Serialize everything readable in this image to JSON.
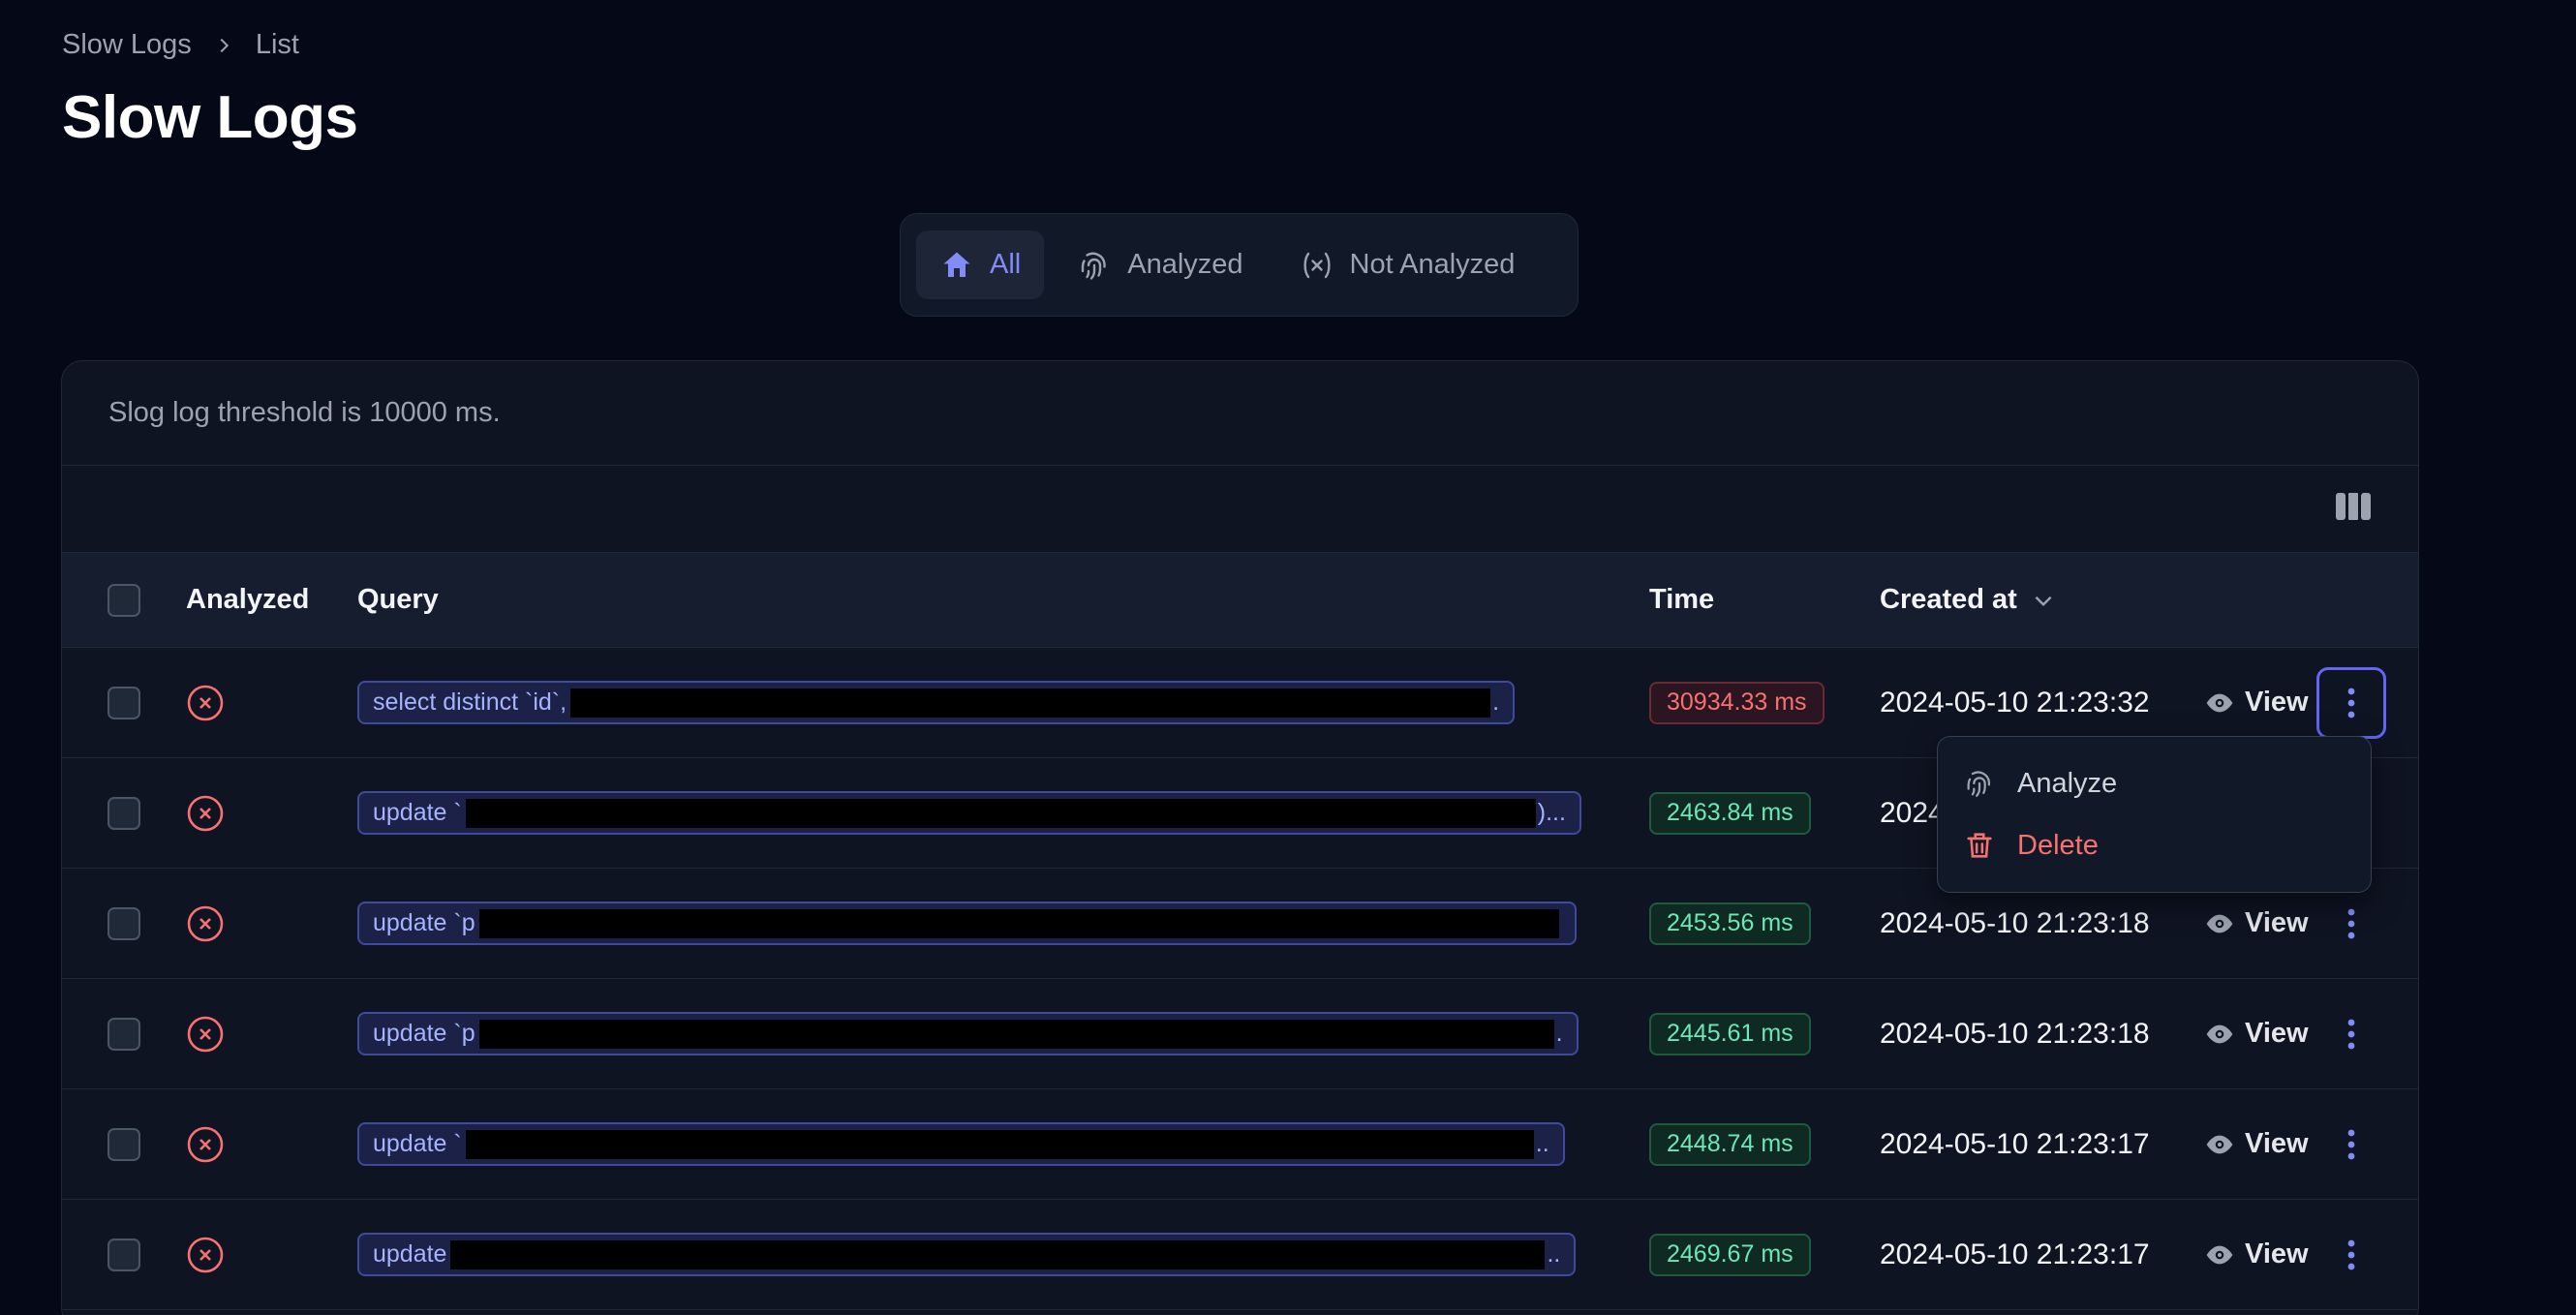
{
  "breadcrumb": {
    "parent": "Slow Logs",
    "current": "List"
  },
  "page_title": "Slow Logs",
  "tabs": [
    {
      "label": "All",
      "icon": "home-icon",
      "active": true
    },
    {
      "label": "Analyzed",
      "icon": "fingerprint-icon",
      "active": false
    },
    {
      "label": "Not Analyzed",
      "icon": "variable-icon",
      "active": false
    }
  ],
  "notice": "Slog log threshold is 10000 ms.",
  "table": {
    "headers": {
      "analyzed": "Analyzed",
      "query": "Query",
      "time": "Time",
      "created_at": "Created at"
    },
    "view_label": "View",
    "rows": [
      {
        "query_prefix": "select distinct `id`,",
        "query_tail": ".",
        "time": "30934.33 ms",
        "time_status": "red",
        "created_at": "2024-05-10 21:23:32"
      },
      {
        "query_prefix": "update `",
        "query_tail": ")...",
        "time": "2463.84 ms",
        "time_status": "green",
        "created_at": "2024-05-10 21:23:19"
      },
      {
        "query_prefix": "update `p",
        "query_tail": "",
        "time": "2453.56 ms",
        "time_status": "green",
        "created_at": "2024-05-10 21:23:18"
      },
      {
        "query_prefix": "update `p",
        "query_tail": ".",
        "time": "2445.61 ms",
        "time_status": "green",
        "created_at": "2024-05-10 21:23:18"
      },
      {
        "query_prefix": "update `",
        "query_tail": "..",
        "time": "2448.74 ms",
        "time_status": "green",
        "created_at": "2024-05-10 21:23:17"
      },
      {
        "query_prefix": "update",
        "query_tail": "..",
        "time": "2469.67 ms",
        "time_status": "green",
        "created_at": "2024-05-10 21:23:17"
      }
    ]
  },
  "dropdown": {
    "analyze_label": "Analyze",
    "delete_label": "Delete"
  },
  "colors": {
    "accent": "#818cf8",
    "danger": "#f87171",
    "success": "#6ee7b7",
    "background": "#050816"
  }
}
